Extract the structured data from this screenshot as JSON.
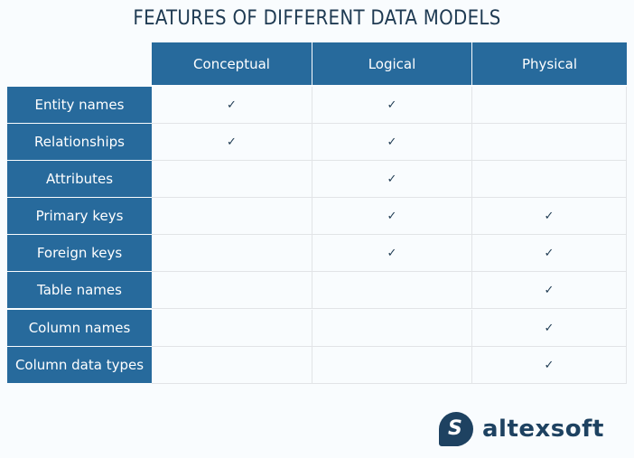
{
  "title": "FEATURES OF DIFFERENT DATA MODELS",
  "columns": [
    "Conceptual",
    "Logical",
    "Physical"
  ],
  "rows": [
    {
      "label": "Entity names",
      "values": [
        true,
        true,
        false
      ]
    },
    {
      "label": "Relationships",
      "values": [
        true,
        true,
        false
      ]
    },
    {
      "label": "Attributes",
      "values": [
        false,
        true,
        false
      ]
    },
    {
      "label": "Primary keys",
      "values": [
        false,
        true,
        true
      ]
    },
    {
      "label": "Foreign keys",
      "values": [
        false,
        true,
        true
      ]
    },
    {
      "label": "Table names",
      "values": [
        false,
        false,
        true
      ]
    },
    {
      "label": "Column names",
      "values": [
        false,
        false,
        true
      ]
    },
    {
      "label": "Column data types",
      "values": [
        false,
        false,
        true
      ]
    }
  ],
  "check_glyph": "✓",
  "logo": {
    "mark": "S",
    "text": "altexsoft"
  },
  "colors": {
    "header_bg": "#276a9c",
    "text_dark": "#1e3a52",
    "logo": "#1e4261"
  }
}
